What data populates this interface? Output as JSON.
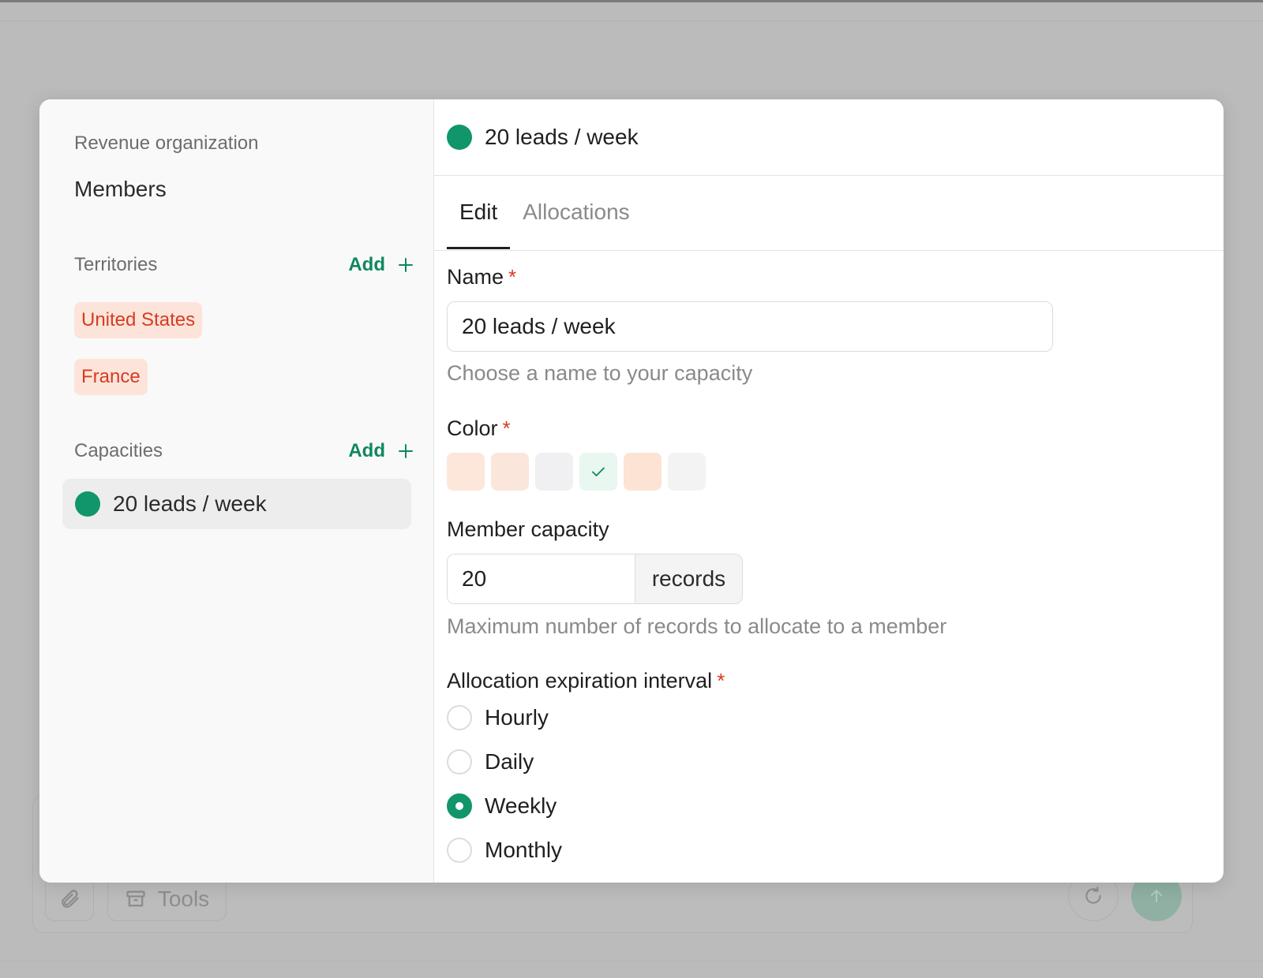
{
  "background": {
    "tools_label": "Tools",
    "attach_icon": "paperclip-icon",
    "tools_icon": "archive-box-icon",
    "refresh_icon": "refresh-icon",
    "send_icon": "arrow-up-icon"
  },
  "sidebar": {
    "org_label": "Revenue organization",
    "members_label": "Members",
    "territories": {
      "label": "Territories",
      "add_label": "Add",
      "items": [
        {
          "label": "United States"
        },
        {
          "label": "France"
        }
      ]
    },
    "capacities": {
      "label": "Capacities",
      "add_label": "Add",
      "items": [
        {
          "label": "20 leads / week",
          "color": "#10966a"
        }
      ]
    }
  },
  "main": {
    "header_title": "20 leads / week",
    "header_color": "#10966a",
    "tabs": [
      {
        "label": "Edit",
        "active": true
      },
      {
        "label": "Allocations",
        "active": false
      }
    ],
    "name_field": {
      "label": "Name",
      "required_mark": "*",
      "value": "20 leads / week",
      "help": "Choose a name to your capacity"
    },
    "color_field": {
      "label": "Color",
      "required_mark": "*",
      "swatches": [
        {
          "color": "#fde7db",
          "selected": false
        },
        {
          "color": "#fbe6dc",
          "selected": false
        },
        {
          "color": "#f0f0f2",
          "selected": false
        },
        {
          "color": "#e8f7ef",
          "selected": true
        },
        {
          "color": "#fde3d3",
          "selected": false
        },
        {
          "color": "#f3f3f3",
          "selected": false
        }
      ]
    },
    "capacity_field": {
      "label": "Member capacity",
      "value": "20",
      "unit": "records",
      "help": "Maximum number of records to allocate to a member"
    },
    "expiration_field": {
      "label": "Allocation expiration interval",
      "required_mark": "*",
      "options": [
        {
          "label": "Hourly",
          "checked": false
        },
        {
          "label": "Daily",
          "checked": false
        },
        {
          "label": "Weekly",
          "checked": true
        },
        {
          "label": "Monthly",
          "checked": false
        }
      ]
    }
  },
  "colors": {
    "accent_green": "#10966a",
    "link_green": "#10875f",
    "tag_bg": "#fde4da",
    "tag_text": "#d63c21",
    "required_red": "#d63c21"
  }
}
